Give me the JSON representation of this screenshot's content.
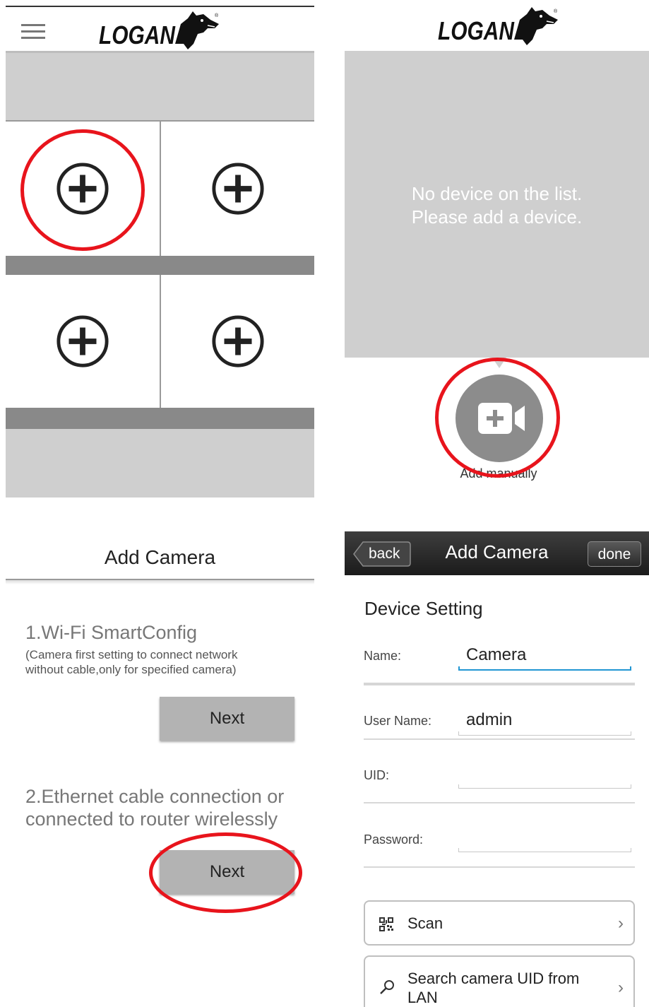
{
  "brand": {
    "logo_text": "LOGAN"
  },
  "panel2": {
    "empty_line1": "No device on the list.",
    "empty_line2": "Please add a device.",
    "add_label": "Add manually"
  },
  "panel3": {
    "title": "Add Camera",
    "option1_title": "1.Wi-Fi SmartConfig",
    "option1_note_line1": "(Camera first setting to connect network",
    "option1_note_line2": "without cable,only for specified camera)",
    "option1_button": "Next",
    "option2_title_line1": "2.Ethernet cable connection or",
    "option2_title_line2": "connected to router wirelessly",
    "option2_button": "Next"
  },
  "panel4": {
    "nav_title": "Add Camera",
    "back_label": "back",
    "done_label": "done",
    "section_title": "Device Setting",
    "fields": {
      "name": {
        "label": "Name:",
        "value": "Camera"
      },
      "username": {
        "label": "User Name:",
        "value": "admin"
      },
      "uid": {
        "label": "UID:",
        "value": ""
      },
      "password": {
        "label": "Password:",
        "value": ""
      }
    },
    "scan_label": "Scan",
    "search_line1": "Search camera UID from",
    "search_line2": "LAN"
  },
  "colors": {
    "highlight": "#e8141c",
    "gray_panel": "#cfcfcf",
    "focus": "#2196d3"
  },
  "icons": [
    "menu-icon",
    "add-circle-icon",
    "add-video-icon",
    "qr-code-icon",
    "search-icon",
    "chevron-right-icon"
  ]
}
